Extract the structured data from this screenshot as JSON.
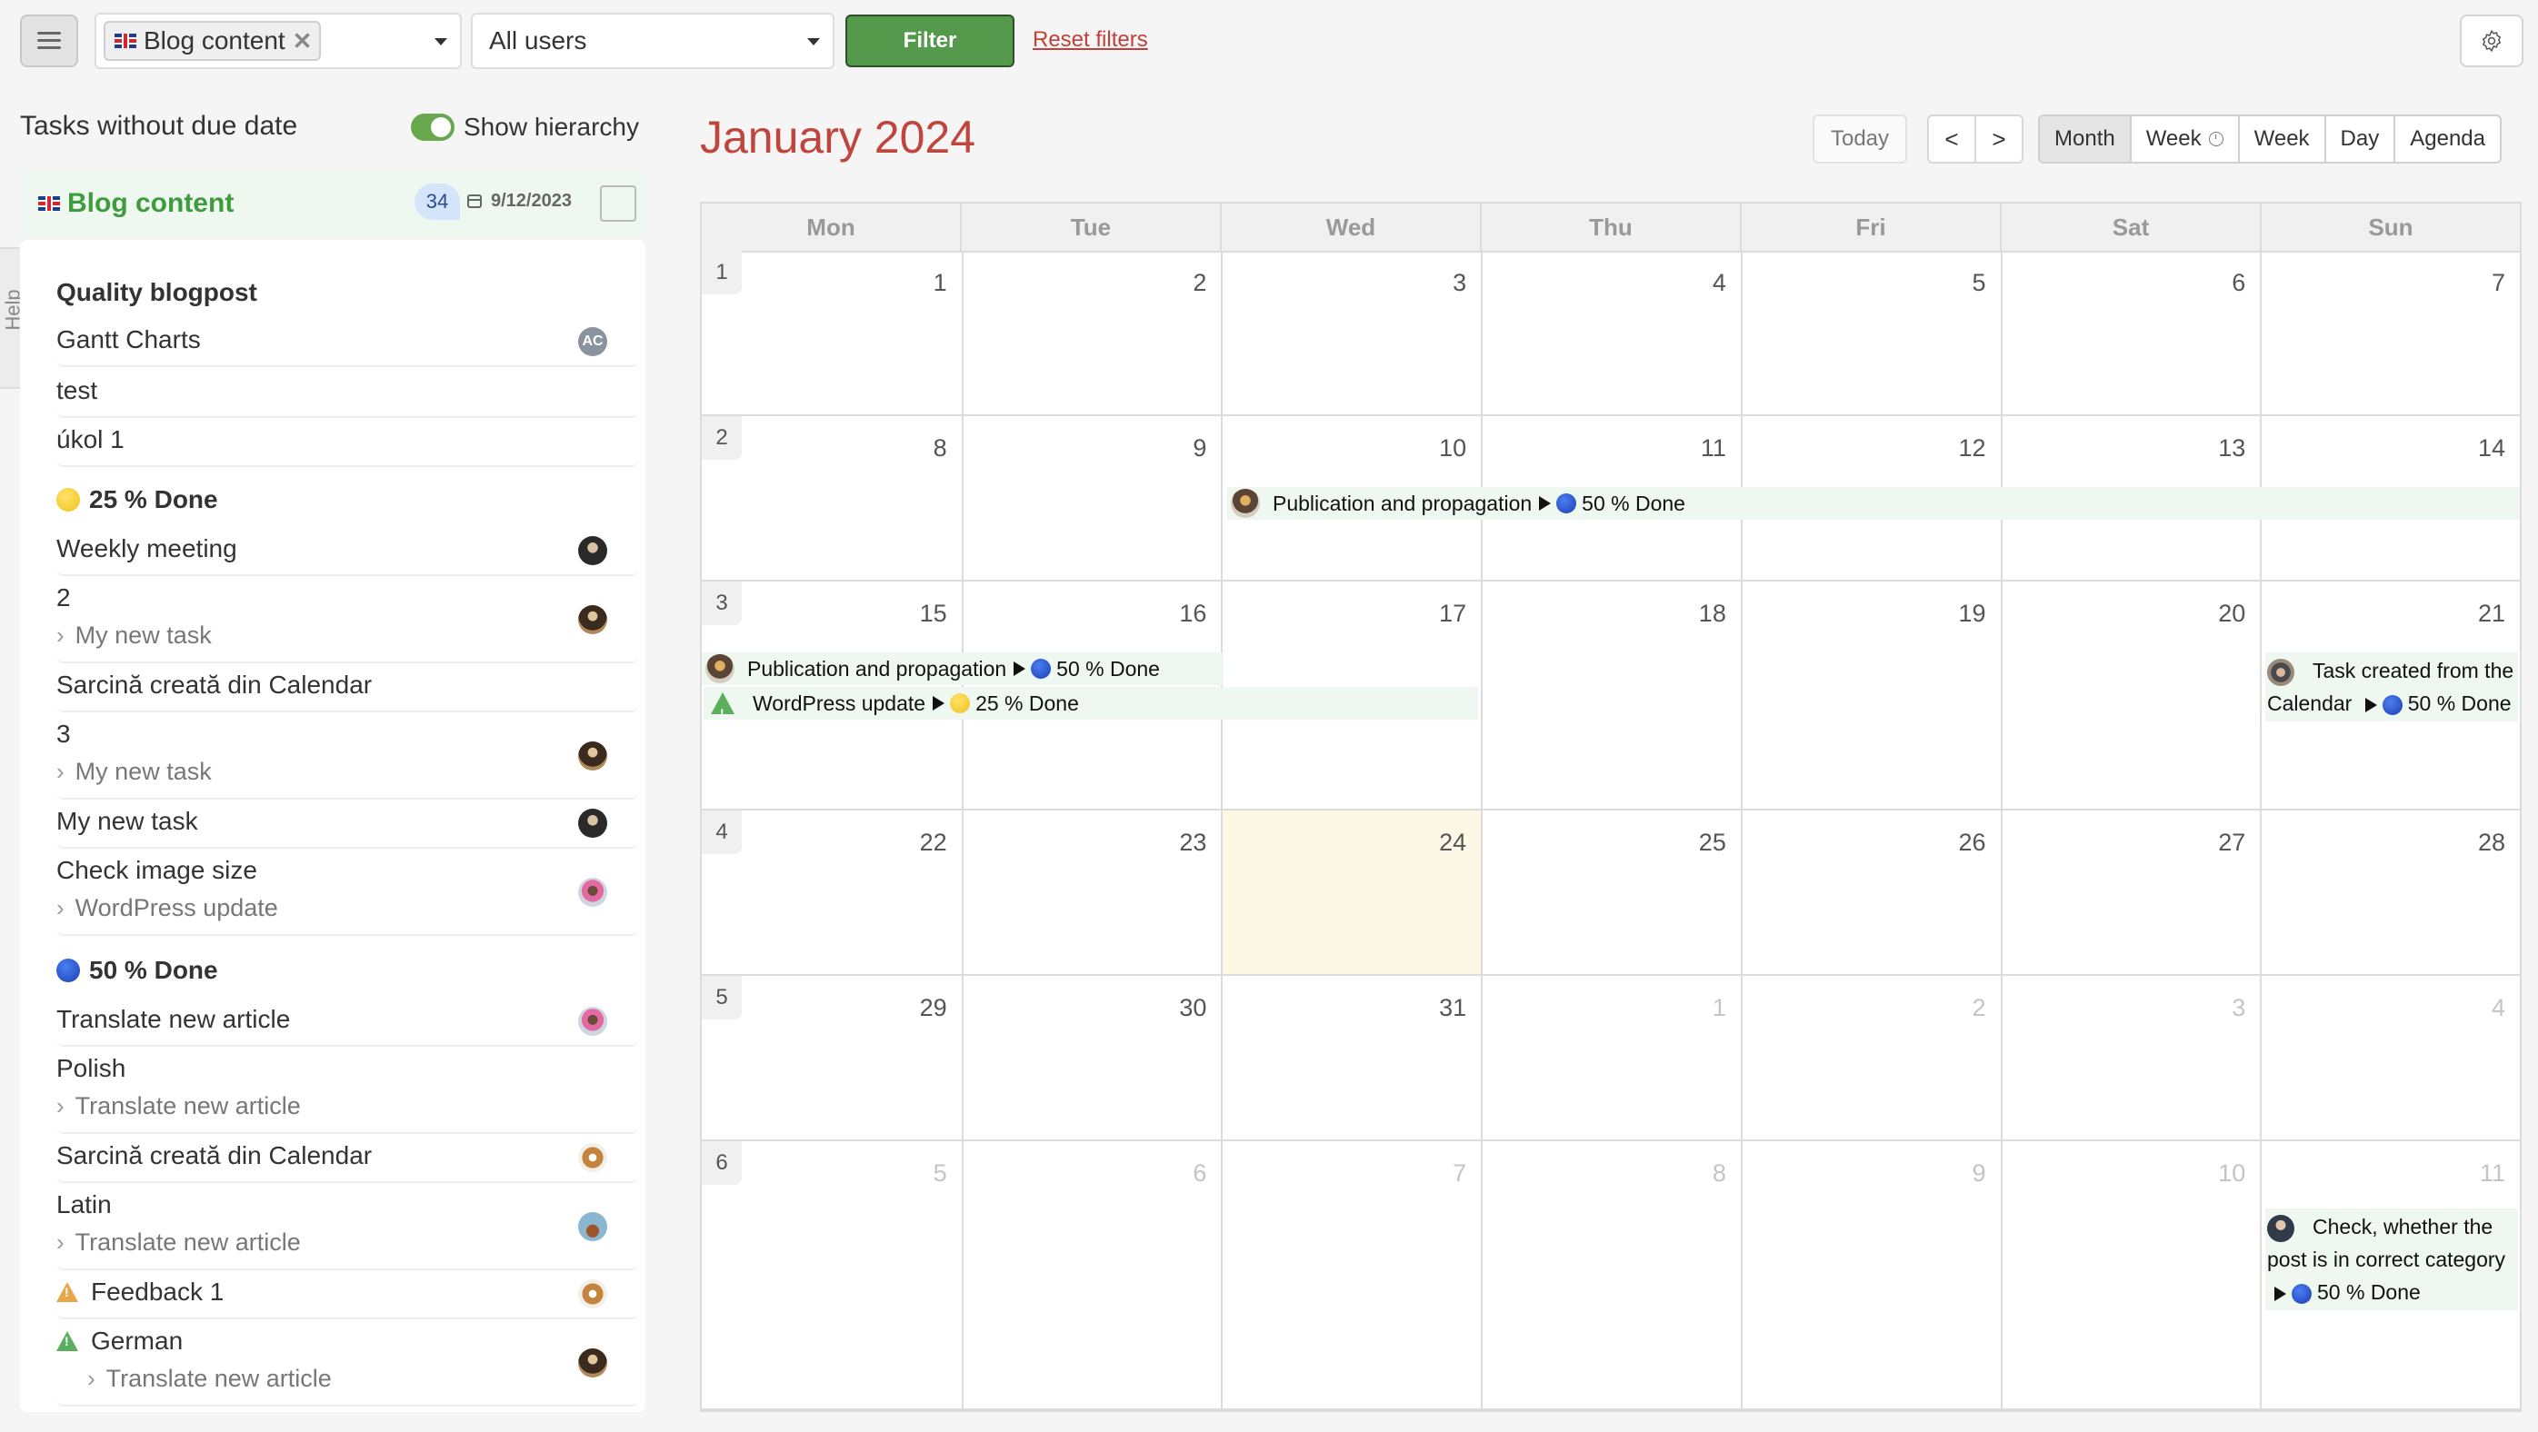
{
  "toolbar": {
    "menu_icon": "hamburger-menu-icon",
    "project_filter": {
      "selected_chip": "Blog content",
      "chip_flag": "uk-flag",
      "remove_icon": "close-icon"
    },
    "user_filter": {
      "selected": "All users"
    },
    "filter_label": "Filter",
    "reset_label": "Reset filters",
    "settings_icon": "gear-icon"
  },
  "left_panel": {
    "title": "Tasks without due date",
    "hierarchy_toggle": {
      "label": "Show hierarchy",
      "on": true
    },
    "help_tab": "Help",
    "project": {
      "name": "Blog content",
      "count": "34",
      "date": "9/12/2023"
    },
    "groups": [
      {
        "heading": "Quality blogpost",
        "status_dot": null,
        "tasks": [
          {
            "title": "Gantt Charts",
            "parent": null,
            "avatar": "AC"
          },
          {
            "title": "test",
            "parent": null,
            "avatar": null
          },
          {
            "title": "úkol 1",
            "parent": null,
            "avatar": null
          }
        ]
      },
      {
        "heading": "25 % Done",
        "status_dot": "yellow",
        "tasks": [
          {
            "title": "Weekly meeting",
            "parent": null,
            "avatar": "photo"
          },
          {
            "title": "2",
            "parent": "My new task",
            "avatar": "photo"
          },
          {
            "title": "Sarcină creată din Calendar",
            "parent": null,
            "avatar": null
          },
          {
            "title": "3",
            "parent": "My new task",
            "avatar": "photo"
          },
          {
            "title": "My new task",
            "parent": null,
            "avatar": "photo"
          },
          {
            "title": "Check image size",
            "parent": "WordPress update",
            "avatar": "photo"
          }
        ]
      },
      {
        "heading": "50 % Done",
        "status_dot": "blue",
        "tasks": [
          {
            "title": "Translate new article",
            "parent": null,
            "avatar": "photo"
          },
          {
            "title": "Polish",
            "parent": "Translate new article",
            "avatar": null
          },
          {
            "title": "Sarcină creată din Calendar",
            "parent": null,
            "avatar": "photo"
          },
          {
            "title": "Latin",
            "parent": "Translate new article",
            "avatar": "photo"
          },
          {
            "title": "Feedback 1",
            "parent": null,
            "avatar": "photo",
            "warning": "orange"
          },
          {
            "title": "German",
            "parent": "Translate new article",
            "avatar": "photo",
            "warning": "green"
          }
        ]
      }
    ]
  },
  "calendar": {
    "title": "January 2024",
    "today_label": "Today",
    "prev_label": "<",
    "next_label": ">",
    "views": [
      "Month",
      "Week",
      "Week",
      "Day",
      "Agenda"
    ],
    "active_view": "Month",
    "weekdays": [
      "Mon",
      "Tue",
      "Wed",
      "Thu",
      "Fri",
      "Sat",
      "Sun"
    ],
    "weeks": [
      {
        "number": "1",
        "days": [
          "1",
          "2",
          "3",
          "4",
          "5",
          "6",
          "7"
        ]
      },
      {
        "number": "2",
        "days": [
          "8",
          "9",
          "10",
          "11",
          "12",
          "13",
          "14"
        ]
      },
      {
        "number": "3",
        "days": [
          "15",
          "16",
          "17",
          "18",
          "19",
          "20",
          "21"
        ]
      },
      {
        "number": "4",
        "days": [
          "22",
          "23",
          "24",
          "25",
          "26",
          "27",
          "28"
        ]
      },
      {
        "number": "5",
        "days": [
          "29",
          "30",
          "31",
          "1",
          "2",
          "3",
          "4"
        ]
      },
      {
        "number": "6",
        "days": [
          "5",
          "6",
          "7",
          "8",
          "9",
          "10",
          "11"
        ]
      }
    ],
    "today": "24",
    "events": [
      {
        "title": "Publication and propagation",
        "status": "50 % Done",
        "status_color": "blue",
        "start": "Jan 10",
        "end": "Jan 14+"
      },
      {
        "title": "Publication and propagation",
        "status": "50 % Done",
        "status_color": "blue",
        "start": "Jan 15",
        "end": "Jan 15"
      },
      {
        "title": "WordPress update",
        "status": "25 % Done",
        "status_color": "yellow",
        "start": "Jan 15",
        "end": "Jan 17",
        "warning": true
      },
      {
        "title": "Task created from the Calendar",
        "status": "50 % Done",
        "status_color": "blue",
        "start": "Jan 21",
        "end": "Jan 21"
      },
      {
        "title": "Check, whether the post is in correct category",
        "status": "50 % Done",
        "status_color": "blue",
        "start": "Feb 11",
        "end": "Feb 11"
      }
    ]
  }
}
